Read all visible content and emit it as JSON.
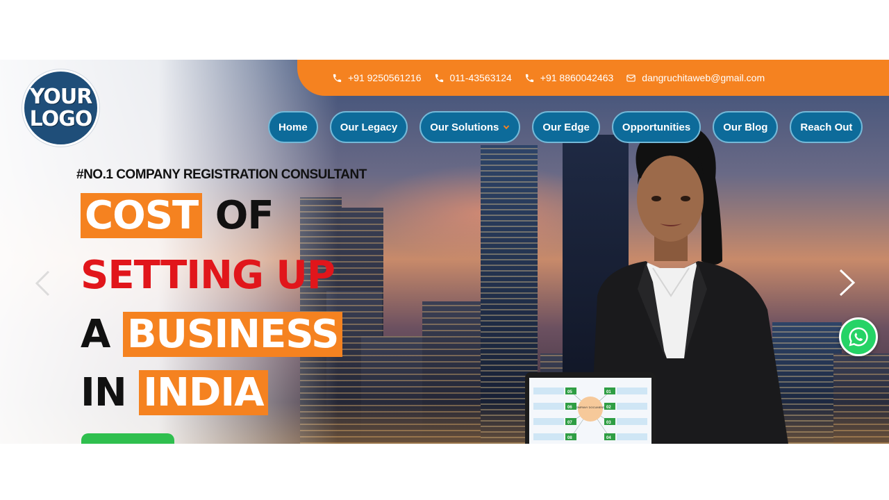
{
  "logo": {
    "line1": "YOUR",
    "line2": "LOGO"
  },
  "topbar": {
    "contacts": [
      {
        "icon": "phone-icon",
        "text": "+91 9250561216"
      },
      {
        "icon": "phone-icon",
        "text": "011-43563124"
      },
      {
        "icon": "phone-icon",
        "text": "+91 8860042463"
      },
      {
        "icon": "email-icon",
        "text": "dangruchitaweb@gmail.com"
      }
    ]
  },
  "nav": {
    "items": [
      {
        "label": "Home"
      },
      {
        "label": "Our Legacy"
      },
      {
        "label": "Our Solutions",
        "has_dropdown": true
      },
      {
        "label": "Our Edge"
      },
      {
        "label": "Opportunities"
      },
      {
        "label": "Our Blog"
      },
      {
        "label": "Reach Out"
      }
    ]
  },
  "hero": {
    "tagline": "#NO.1 COMPANY REGISTRATION CONSULTANT",
    "headline": {
      "line1_box": "COST",
      "line1_rest": "OF",
      "line2": "SETTING UP",
      "line3_pre": "A",
      "line3_box": "BUSINESS",
      "line4_pre": "IN",
      "line4_box": "INDIA"
    },
    "tablet_labels": [
      "COMPANY DOCUMENTS",
      "01",
      "02",
      "03",
      "04",
      "05",
      "06",
      "07",
      "08"
    ]
  },
  "colors": {
    "accent_orange": "#f58220",
    "nav_blue": "#0d6b9a",
    "headline_red": "#e1161b",
    "whatsapp_green": "#25d366"
  }
}
